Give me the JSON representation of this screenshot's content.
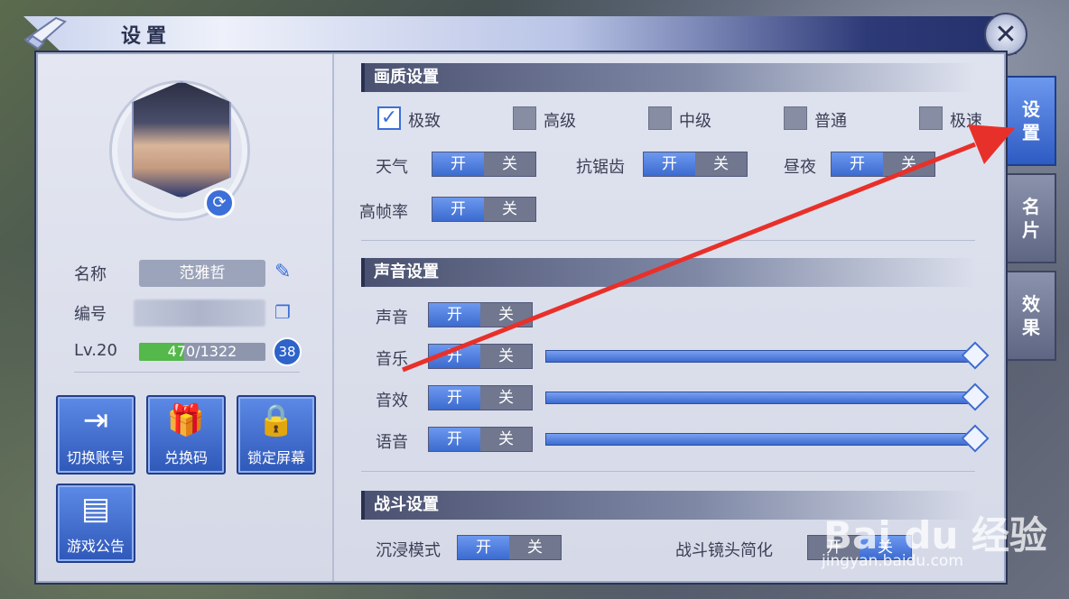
{
  "header": {
    "title": "设置"
  },
  "profile": {
    "name_label": "名称",
    "name_value": "范雅哲",
    "id_label": "编号",
    "level_label": "Lv.20",
    "exp_text": "470/1322",
    "exp_fraction": 0.356,
    "level_badge": "38"
  },
  "actions": [
    {
      "label": "切换账号",
      "icon": "logout-icon"
    },
    {
      "label": "兑换码",
      "icon": "gift-icon"
    },
    {
      "label": "锁定屏幕",
      "icon": "lock-icon"
    },
    {
      "label": "游戏公告",
      "icon": "billboard-icon"
    }
  ],
  "graphics": {
    "header": "画质设置",
    "quality_options": [
      {
        "label": "极致",
        "checked": true
      },
      {
        "label": "高级",
        "checked": false
      },
      {
        "label": "中级",
        "checked": false
      },
      {
        "label": "普通",
        "checked": false
      },
      {
        "label": "极速",
        "checked": false
      }
    ],
    "weather_label": "天气",
    "antialias_label": "抗锯齿",
    "daynight_label": "昼夜",
    "highfps_label": "高帧率"
  },
  "toggle_text": {
    "on": "开",
    "off": "关"
  },
  "audio": {
    "header": "声音设置",
    "sound_label": "声音",
    "music_label": "音乐",
    "sfx_label": "音效",
    "voice_label": "语音",
    "music_level": 1.0,
    "sfx_level": 1.0,
    "voice_level": 1.0
  },
  "battle": {
    "header": "战斗设置",
    "immersive_label": "沉浸模式",
    "camera_label": "战斗镜头简化"
  },
  "tabs": [
    {
      "label": "设置",
      "active": true
    },
    {
      "label": "名片",
      "active": false
    },
    {
      "label": "效果",
      "active": false
    }
  ],
  "watermark": {
    "main": "Bai du 经验",
    "sub": "jingyan.baidu.com"
  },
  "colors": {
    "accent": "#3c6bd0",
    "exp_bar": "#54b84a",
    "annotation_arrow": "#e8302a"
  }
}
